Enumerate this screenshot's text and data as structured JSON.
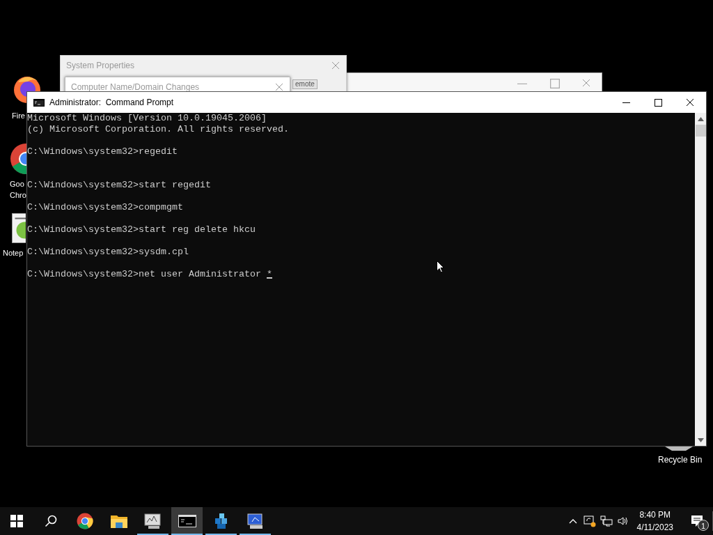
{
  "desktop_icons": [
    {
      "kind": "firefox",
      "label": "Fire"
    },
    {
      "kind": "chrome",
      "label": "Goo Chro"
    },
    {
      "kind": "notepad",
      "label": "Notep"
    },
    {
      "kind": "recycle",
      "label": "Recycle Bin"
    }
  ],
  "background_windows": [
    {
      "kind": "blank"
    },
    {
      "kind": "system_properties",
      "title": "System Properties",
      "button": "emote"
    },
    {
      "kind": "dialog",
      "title": "Computer Name/Domain Changes"
    }
  ],
  "command_prompt": {
    "title": "Administrator:  Command Prompt",
    "lines": [
      {
        "kind": "text",
        "text": "Microsoft Windows [Version 10.0.19045.2006]"
      },
      {
        "kind": "text",
        "text": "(c) Microsoft Corporation. All rights reserved."
      },
      {
        "kind": "blank"
      },
      {
        "kind": "text",
        "text": "C:\\Windows\\system32>regedit"
      },
      {
        "kind": "blank"
      },
      {
        "kind": "blank"
      },
      {
        "kind": "text",
        "text": "C:\\Windows\\system32>start regedit"
      },
      {
        "kind": "blank"
      },
      {
        "kind": "text",
        "text": "C:\\Windows\\system32>compmgmt"
      },
      {
        "kind": "blank"
      },
      {
        "kind": "text",
        "text": "C:\\Windows\\system32>start reg delete hkcu"
      },
      {
        "kind": "blank"
      },
      {
        "kind": "text",
        "text": "C:\\Windows\\system32>sysdm.cpl"
      },
      {
        "kind": "blank"
      },
      {
        "kind": "input",
        "text": "C:\\Windows\\system32>net user Administrator *"
      }
    ]
  },
  "taskbar": {
    "apps": [
      {
        "kind": "start",
        "running": false,
        "selected": false
      },
      {
        "kind": "search",
        "running": false,
        "selected": false
      },
      {
        "kind": "chrome",
        "running": false,
        "selected": false
      },
      {
        "kind": "folder",
        "running": false,
        "selected": false
      },
      {
        "kind": "monitor",
        "running": true,
        "selected": false
      },
      {
        "kind": "cmd",
        "running": true,
        "selected": true
      },
      {
        "kind": "registry",
        "running": true,
        "selected": false
      },
      {
        "kind": "computer",
        "running": true,
        "selected": false
      }
    ],
    "tray": [
      {
        "kind": "chevron"
      },
      {
        "kind": "sync"
      },
      {
        "kind": "network"
      },
      {
        "kind": "volume"
      }
    ],
    "time": "8:40 PM",
    "date": "4/11/2023",
    "notification_count": "1"
  }
}
